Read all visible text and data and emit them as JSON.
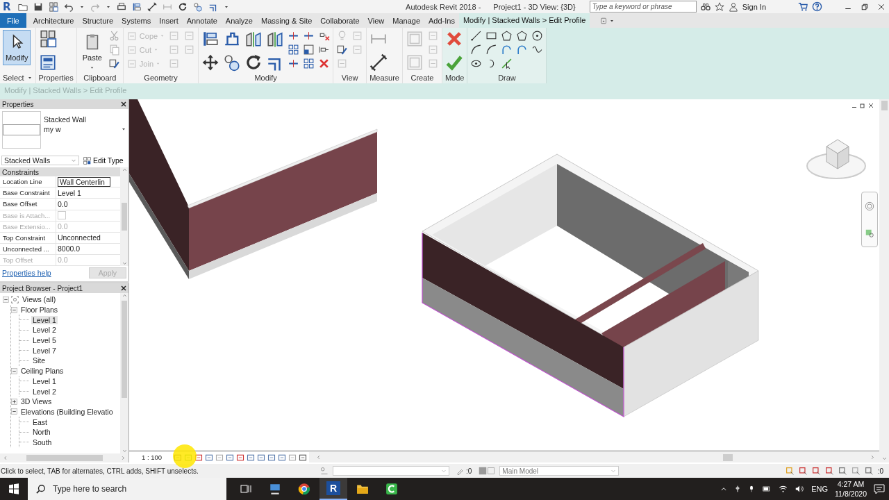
{
  "title_bar": {
    "app_logo": "R",
    "app_title": "Autodesk Revit 2018 -",
    "document_title": "Project1 - 3D View: {3D}",
    "search": {
      "placeholder": "Type a keyword or phrase"
    },
    "sign_in": "Sign In"
  },
  "ribbon_tabs": [
    {
      "label": "File",
      "kind": "file",
      "selected": false
    },
    {
      "label": "Architecture",
      "kind": "tab",
      "selected": false
    },
    {
      "label": "Structure",
      "kind": "tab",
      "selected": false
    },
    {
      "label": "Systems",
      "kind": "tab",
      "selected": false
    },
    {
      "label": "Insert",
      "kind": "tab",
      "selected": false
    },
    {
      "label": "Annotate",
      "kind": "tab",
      "selected": false
    },
    {
      "label": "Analyze",
      "kind": "tab",
      "selected": false
    },
    {
      "label": "Massing & Site",
      "kind": "tab",
      "selected": false
    },
    {
      "label": "Collaborate",
      "kind": "tab",
      "selected": false
    },
    {
      "label": "View",
      "kind": "tab",
      "selected": false
    },
    {
      "label": "Manage",
      "kind": "tab",
      "selected": false
    },
    {
      "label": "Add-Ins",
      "kind": "tab",
      "selected": false
    },
    {
      "label": "Modify | Stacked Walls > Edit Profile",
      "kind": "context",
      "selected": true
    }
  ],
  "ribbon_panels": [
    {
      "title": "Select",
      "dropdown": true,
      "tools": [
        {
          "label": "Modify",
          "kind": "large",
          "selected": true
        }
      ]
    },
    {
      "title": "Properties"
    },
    {
      "title": "Clipboard",
      "tools": [
        {
          "label": "Paste",
          "kind": "large",
          "selected": false
        }
      ]
    },
    {
      "title": "Geometry",
      "tools": [
        {
          "label": "Cope",
          "kind": "small",
          "disabled": true
        },
        {
          "label": "Cut",
          "kind": "small",
          "disabled": true
        },
        {
          "label": "Join",
          "kind": "small",
          "disabled": true
        }
      ]
    },
    {
      "title": "Modify"
    },
    {
      "title": "View"
    },
    {
      "title": "Measure"
    },
    {
      "title": "Create"
    },
    {
      "title": "Mode",
      "contextual": true
    },
    {
      "title": "Draw",
      "contextual": true
    }
  ],
  "options_bar": {
    "text": "Modify | Stacked Walls > Edit Profile"
  },
  "properties": {
    "title": "Properties",
    "type_name": "Stacked Wall",
    "type_detail": "my w",
    "family": "Stacked Walls",
    "edit_type": "Edit Type",
    "group": "Constraints",
    "rows": [
      {
        "name": "Location Line",
        "value": "Wall Centerlin",
        "kind": "field",
        "disabled": false
      },
      {
        "name": "Base Constraint",
        "value": "Level 1",
        "kind": "text",
        "disabled": false
      },
      {
        "name": "Base Offset",
        "value": "0.0",
        "kind": "text",
        "disabled": false
      },
      {
        "name": "Base is Attach...",
        "kind": "checkbox",
        "checked": false,
        "disabled": true
      },
      {
        "name": "Base Extensio...",
        "value": "0.0",
        "kind": "text",
        "disabled": true
      },
      {
        "name": "Top Constraint",
        "value": "Unconnected",
        "kind": "text",
        "disabled": false
      },
      {
        "name": "Unconnected ...",
        "value": "8000.0",
        "kind": "text",
        "disabled": false
      },
      {
        "name": "Top Offset",
        "value": "0.0",
        "kind": "text",
        "disabled": true
      }
    ],
    "help_link": "Properties help",
    "apply": {
      "label": "Apply",
      "disabled": true
    }
  },
  "project_browser": {
    "title": "Project Browser - Project1",
    "tree": [
      {
        "label": "Views (all)",
        "expanded": true,
        "selected": false,
        "children": [
          {
            "label": "Floor Plans",
            "expanded": true,
            "selected": false,
            "children": [
              {
                "label": "Level 1",
                "selected": true
              },
              {
                "label": "Level 2",
                "selected": false
              },
              {
                "label": "Level 5",
                "selected": false
              },
              {
                "label": "Level 7",
                "selected": false
              },
              {
                "label": "Site",
                "selected": false
              }
            ]
          },
          {
            "label": "Ceiling Plans",
            "expanded": true,
            "selected": false,
            "children": [
              {
                "label": "Level 1",
                "selected": false
              },
              {
                "label": "Level 2",
                "selected": false
              }
            ]
          },
          {
            "label": "3D Views",
            "expanded": false,
            "selected": false
          },
          {
            "label": "Elevations (Building Elevatio",
            "expanded": true,
            "selected": false,
            "children": [
              {
                "label": "East",
                "selected": false
              },
              {
                "label": "North",
                "selected": false
              },
              {
                "label": "South",
                "selected": false
              }
            ]
          }
        ]
      }
    ]
  },
  "view_bar": {
    "scale": "1 : 100"
  },
  "status_bar": {
    "message": "Click to select, TAB for alternates, CTRL adds, SHIFT unselects.",
    "editable_count": ":0",
    "model": "Main Model",
    "selection_count": ":0"
  },
  "taskbar": {
    "search_placeholder": "Type here to search",
    "app_logo": "R",
    "language": "ENG",
    "time": "4:27 AM",
    "date": "11/8/2020"
  }
}
